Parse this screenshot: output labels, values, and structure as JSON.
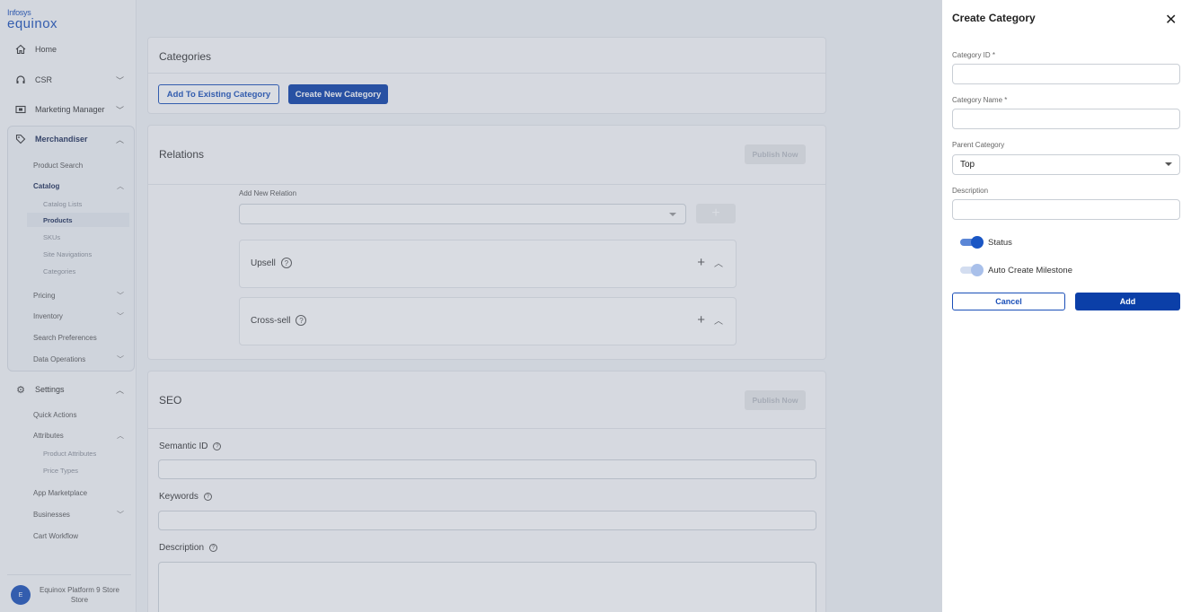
{
  "brand": {
    "line1": "Infosys",
    "line2": "equinox"
  },
  "sidebar": {
    "items": [
      {
        "label": "Home"
      },
      {
        "label": "CSR"
      },
      {
        "label": "Marketing Manager"
      },
      {
        "label": "Merchandiser"
      },
      {
        "label": "Settings"
      }
    ],
    "merchandiser_sub": {
      "product_search": "Product Search",
      "catalog": "Catalog",
      "catalog_lists": "Catalog Lists",
      "products": "Products",
      "skus": "SKUs",
      "site_navigations": "Site Navigations",
      "categories": "Categories",
      "pricing": "Pricing",
      "inventory": "Inventory",
      "search_preferences": "Search Preferences",
      "data_operations": "Data Operations"
    },
    "settings_sub": {
      "quick_actions": "Quick Actions",
      "attributes": "Attributes",
      "product_attributes": "Product Attributes",
      "price_types": "Price Types",
      "app_marketplace": "App Marketplace",
      "businesses": "Businesses",
      "cart_workflow": "Cart Workflow"
    },
    "store": {
      "avatar": "E",
      "name": "Equinox Platform 9 Store",
      "type": "Store"
    }
  },
  "categories_card": {
    "title": "Categories",
    "add_existing": "Add To Existing Category",
    "create_new": "Create New Category"
  },
  "relations_card": {
    "title": "Relations",
    "publish": "Publish Now",
    "add_label": "Add New Relation",
    "plus": "+",
    "relations": [
      {
        "label": "Upsell"
      },
      {
        "label": "Cross-sell"
      }
    ]
  },
  "seo_card": {
    "title": "SEO",
    "publish": "Publish Now",
    "semantic_id": "Semantic ID",
    "keywords": "Keywords",
    "description": "Description"
  },
  "drawer": {
    "title": "Create Category",
    "close": "✕",
    "category_id_label": "Category ID",
    "category_name_label": "Category Name",
    "required": "*",
    "parent_label": "Parent Category",
    "parent_value": "Top",
    "description_label": "Description",
    "status_label": "Status",
    "milestone_label": "Auto Create Milestone",
    "cancel": "Cancel",
    "add": "Add"
  },
  "colors": {
    "primary": "#0b3fa8",
    "toggle_on": "#1a56c4",
    "toggle_off": "#a9c0ea"
  }
}
